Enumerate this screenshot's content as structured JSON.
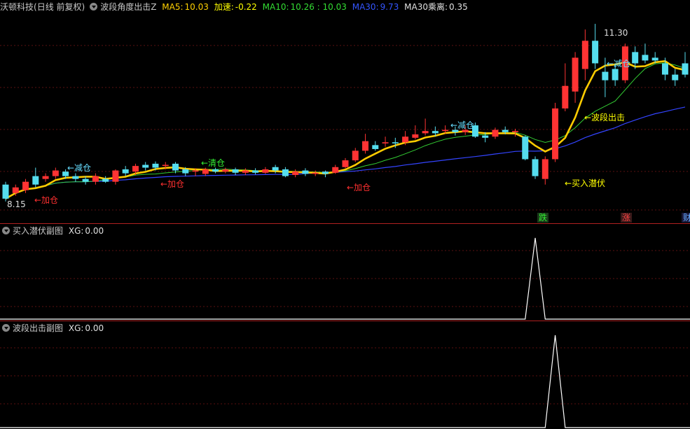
{
  "header": {
    "stock": "沃顿科技",
    "period": "(日线 前复权)",
    "indicator": "波段角度出击Z",
    "ma5_label": "MA5:",
    "ma5_value": "10.03",
    "speed_label": "加速:",
    "speed_value": "-0.22",
    "ma10_label": "MA10:",
    "ma10_value": "10.26 : 10.03",
    "ma30_label": "MA30:",
    "ma30_value": "9.73",
    "dev_label": "MA30乘离:",
    "dev_value": "0.35",
    "colors": {
      "stock": "#c8c8c8",
      "ma5": "#ffd000",
      "speed": "#ffff00",
      "ma10": "#33dd33",
      "ma30": "#3355ff",
      "dev": "#e0e0e0"
    }
  },
  "price_labels": {
    "high": "11.30",
    "low": "8.15"
  },
  "signals": {
    "add1": "←加仓",
    "reduce1": "←减仓",
    "add2": "←加仓",
    "clear": "←清仓",
    "add3": "←加仓",
    "reduce2": "←减仓",
    "reduce3": "←减仓",
    "attack": "←波段出击",
    "buy": "←买入潜伏"
  },
  "badges": {
    "fall": "跌",
    "rise": "涨",
    "fin": "财"
  },
  "sub1": {
    "title": "买入潜伏副图",
    "xg_label": "XG:",
    "xg_value": "0.00"
  },
  "sub2": {
    "title": "波段出击副图",
    "xg_label": "XG:",
    "xg_value": "0.00"
  },
  "chart_data": {
    "type": "candlestick",
    "price_range": [
      8.0,
      11.45
    ],
    "candles": [
      {
        "o": 8.45,
        "c": 8.2,
        "h": 8.5,
        "l": 8.15
      },
      {
        "o": 8.3,
        "c": 8.4,
        "h": 8.45,
        "l": 8.25
      },
      {
        "o": 8.35,
        "c": 8.5,
        "h": 8.55,
        "l": 8.3
      },
      {
        "o": 8.6,
        "c": 8.45,
        "h": 8.75,
        "l": 8.4
      },
      {
        "o": 8.55,
        "c": 8.6,
        "h": 8.65,
        "l": 8.5
      },
      {
        "o": 8.6,
        "c": 8.7,
        "h": 8.75,
        "l": 8.55
      },
      {
        "o": 8.68,
        "c": 8.6,
        "h": 8.72,
        "l": 8.55
      },
      {
        "o": 8.6,
        "c": 8.55,
        "h": 8.65,
        "l": 8.5
      },
      {
        "o": 8.55,
        "c": 8.5,
        "h": 8.6,
        "l": 8.45
      },
      {
        "o": 8.5,
        "c": 8.6,
        "h": 8.65,
        "l": 8.45
      },
      {
        "o": 8.55,
        "c": 8.5,
        "h": 8.6,
        "l": 8.48
      },
      {
        "o": 8.5,
        "c": 8.7,
        "h": 8.72,
        "l": 8.45
      },
      {
        "o": 8.72,
        "c": 8.65,
        "h": 8.78,
        "l": 8.6
      },
      {
        "o": 8.68,
        "c": 8.78,
        "h": 8.82,
        "l": 8.62
      },
      {
        "o": 8.8,
        "c": 8.75,
        "h": 8.85,
        "l": 8.7
      },
      {
        "o": 8.82,
        "c": 8.75,
        "h": 8.86,
        "l": 8.7
      },
      {
        "o": 8.78,
        "c": 8.8,
        "h": 8.85,
        "l": 8.72
      },
      {
        "o": 8.82,
        "c": 8.7,
        "h": 8.85,
        "l": 8.65
      },
      {
        "o": 8.72,
        "c": 8.65,
        "h": 8.76,
        "l": 8.6
      },
      {
        "o": 8.68,
        "c": 8.7,
        "h": 8.74,
        "l": 8.6
      },
      {
        "o": 8.64,
        "c": 8.72,
        "h": 8.75,
        "l": 8.6
      },
      {
        "o": 8.72,
        "c": 8.68,
        "h": 8.75,
        "l": 8.65
      },
      {
        "o": 8.68,
        "c": 8.72,
        "h": 8.75,
        "l": 8.65
      },
      {
        "o": 8.72,
        "c": 8.66,
        "h": 8.75,
        "l": 8.62
      },
      {
        "o": 8.66,
        "c": 8.7,
        "h": 8.74,
        "l": 8.62
      },
      {
        "o": 8.7,
        "c": 8.66,
        "h": 8.74,
        "l": 8.63
      },
      {
        "o": 8.66,
        "c": 8.72,
        "h": 8.76,
        "l": 8.64
      },
      {
        "o": 8.76,
        "c": 8.7,
        "h": 8.8,
        "l": 8.65
      },
      {
        "o": 8.72,
        "c": 8.6,
        "h": 8.76,
        "l": 8.58
      },
      {
        "o": 8.62,
        "c": 8.68,
        "h": 8.72,
        "l": 8.58
      },
      {
        "o": 8.7,
        "c": 8.64,
        "h": 8.74,
        "l": 8.6
      },
      {
        "o": 8.64,
        "c": 8.66,
        "h": 8.7,
        "l": 8.6
      },
      {
        "o": 8.68,
        "c": 8.64,
        "h": 8.7,
        "l": 8.58
      },
      {
        "o": 8.66,
        "c": 8.76,
        "h": 8.8,
        "l": 8.64
      },
      {
        "o": 8.76,
        "c": 8.88,
        "h": 8.92,
        "l": 8.74
      },
      {
        "o": 8.88,
        "c": 9.05,
        "h": 9.1,
        "l": 8.85
      },
      {
        "o": 9.05,
        "c": 9.22,
        "h": 9.35,
        "l": 9.0
      },
      {
        "o": 9.15,
        "c": 9.08,
        "h": 9.22,
        "l": 9.05
      },
      {
        "o": 9.18,
        "c": 9.2,
        "h": 9.3,
        "l": 9.12
      },
      {
        "o": 9.2,
        "c": 9.18,
        "h": 9.28,
        "l": 9.1
      },
      {
        "o": 9.2,
        "c": 9.3,
        "h": 9.4,
        "l": 9.15
      },
      {
        "o": 9.28,
        "c": 9.34,
        "h": 9.5,
        "l": 9.25
      },
      {
        "o": 9.36,
        "c": 9.4,
        "h": 9.62,
        "l": 9.32
      },
      {
        "o": 9.4,
        "c": 9.36,
        "h": 9.48,
        "l": 9.3
      },
      {
        "o": 9.4,
        "c": 9.42,
        "h": 9.5,
        "l": 9.35
      },
      {
        "o": 9.42,
        "c": 9.38,
        "h": 9.48,
        "l": 9.32
      },
      {
        "o": 9.38,
        "c": 9.42,
        "h": 9.5,
        "l": 9.33
      },
      {
        "o": 9.5,
        "c": 9.3,
        "h": 9.55,
        "l": 9.28
      },
      {
        "o": 9.32,
        "c": 9.28,
        "h": 9.38,
        "l": 9.2
      },
      {
        "o": 9.3,
        "c": 9.42,
        "h": 9.46,
        "l": 9.26
      },
      {
        "o": 9.42,
        "c": 9.38,
        "h": 9.48,
        "l": 9.34
      },
      {
        "o": 9.38,
        "c": 9.4,
        "h": 9.44,
        "l": 9.3
      },
      {
        "o": 9.3,
        "c": 8.9,
        "h": 9.32,
        "l": 8.88
      },
      {
        "o": 8.9,
        "c": 8.6,
        "h": 8.95,
        "l": 8.55
      },
      {
        "o": 8.55,
        "c": 8.9,
        "h": 8.95,
        "l": 8.45
      },
      {
        "o": 8.9,
        "c": 9.8,
        "h": 9.9,
        "l": 8.85
      },
      {
        "o": 9.8,
        "c": 10.2,
        "h": 10.6,
        "l": 9.75
      },
      {
        "o": 10.1,
        "c": 10.7,
        "h": 10.8,
        "l": 9.9
      },
      {
        "o": 10.5,
        "c": 11.0,
        "h": 11.2,
        "l": 10.3
      },
      {
        "o": 11.0,
        "c": 10.6,
        "h": 11.3,
        "l": 10.5
      },
      {
        "o": 10.45,
        "c": 10.3,
        "h": 10.7,
        "l": 10.0
      },
      {
        "o": 10.5,
        "c": 10.3,
        "h": 10.6,
        "l": 10.2
      },
      {
        "o": 10.3,
        "c": 10.9,
        "h": 10.95,
        "l": 10.25
      },
      {
        "o": 10.8,
        "c": 10.6,
        "h": 10.9,
        "l": 10.5
      },
      {
        "o": 10.75,
        "c": 10.65,
        "h": 10.95,
        "l": 10.6
      },
      {
        "o": 10.7,
        "c": 10.65,
        "h": 10.8,
        "l": 10.6
      },
      {
        "o": 10.6,
        "c": 10.4,
        "h": 10.7,
        "l": 10.3
      },
      {
        "o": 10.4,
        "c": 10.3,
        "h": 10.5,
        "l": 10.2
      },
      {
        "o": 10.6,
        "c": 10.4,
        "h": 10.8,
        "l": 10.35
      }
    ],
    "subcharts": [
      {
        "title": "买入潜伏副图",
        "peak_index": 53,
        "value": 0.0
      },
      {
        "title": "波段出击副图",
        "peak_index": 55,
        "value": 0.0
      }
    ]
  }
}
